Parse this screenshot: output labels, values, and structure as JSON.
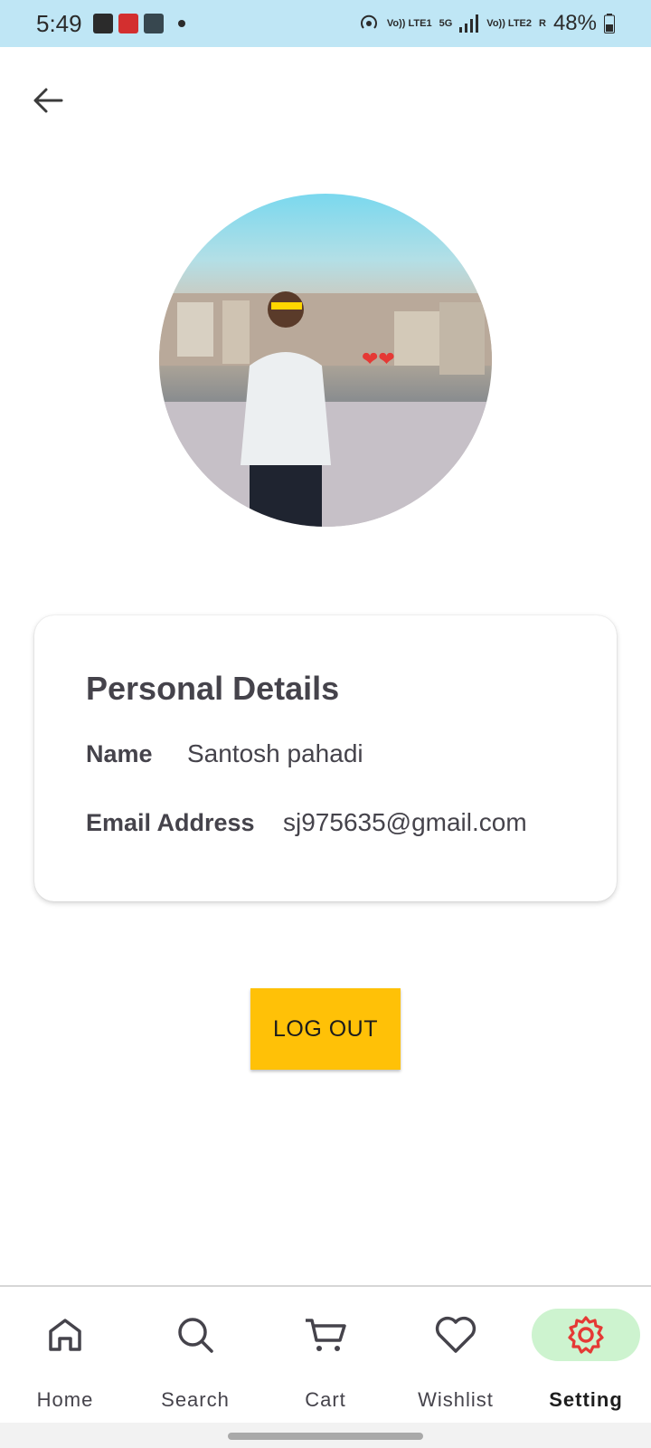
{
  "status_bar": {
    "time": "5:49",
    "battery_percent": "48%",
    "network_labels": [
      "Vo)) LTE1",
      "5G",
      "Vo)) LTE2",
      "R"
    ]
  },
  "profile": {
    "avatar_description": "profile-photo",
    "card_title": "Personal Details",
    "name_label": "Name",
    "name_value": "Santosh pahadi",
    "email_label": "Email Address",
    "email_value": "sj975635@gmail.com"
  },
  "actions": {
    "logout_label": "LOG OUT"
  },
  "nav": {
    "items": [
      {
        "label": "Home",
        "icon": "home-icon"
      },
      {
        "label": "Search",
        "icon": "search-icon"
      },
      {
        "label": "Cart",
        "icon": "cart-icon"
      },
      {
        "label": "Wishlist",
        "icon": "heart-icon"
      },
      {
        "label": "Setting",
        "icon": "gear-icon"
      }
    ],
    "active": "Setting",
    "active_color": "#e53935",
    "active_bg": "#cdf3cf"
  },
  "colors": {
    "status_bar": "#bfe6f5",
    "logout_button": "#ffc107",
    "text": "#45434b"
  }
}
